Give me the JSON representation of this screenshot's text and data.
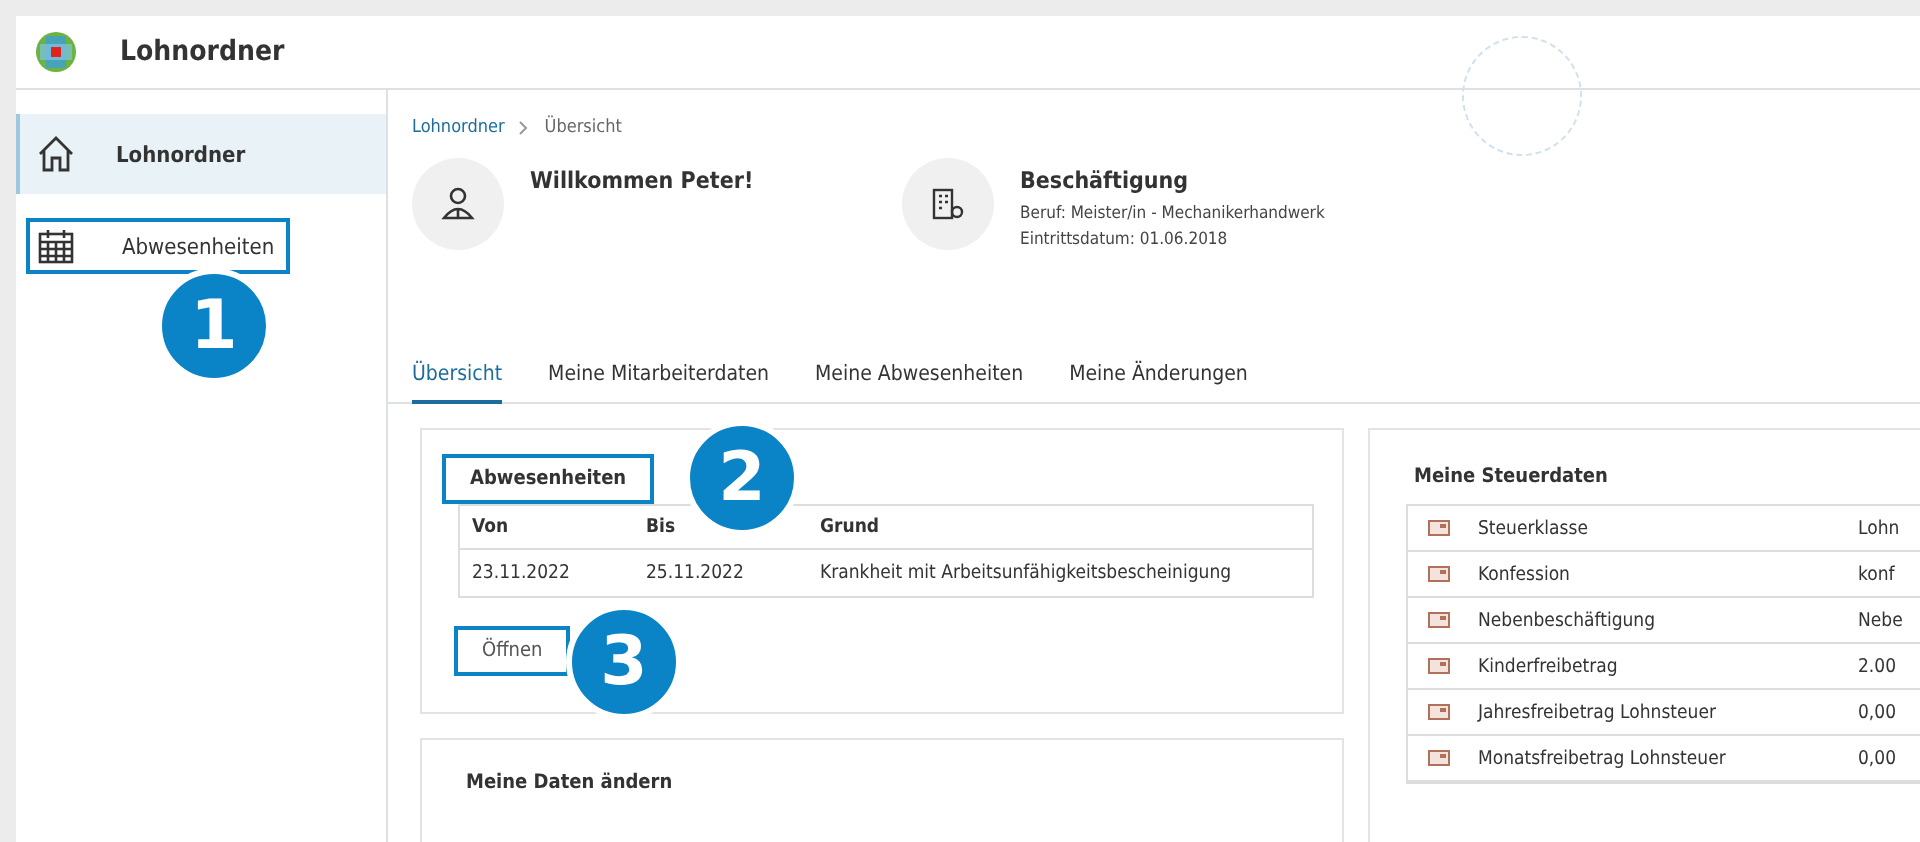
{
  "app": {
    "title": "Lohnordner"
  },
  "sidebar": {
    "items": [
      {
        "label": "Lohnordner",
        "kind": "home",
        "selected": true
      },
      {
        "label": "Abwesenheiten",
        "kind": "calendar",
        "selected": false,
        "callout": "1"
      }
    ]
  },
  "breadcrumb": [
    "Lohnordner",
    "Übersicht"
  ],
  "welcome": {
    "title": "Willkommen Peter!"
  },
  "employment": {
    "title": "Beschäftigung",
    "lines": [
      "Beruf: Meister/in - Mechanikerhandwerk",
      "Eintrittsdatum: 01.06.2018"
    ]
  },
  "tabs": [
    {
      "label": "Übersicht",
      "selected": true
    },
    {
      "label": "Meine Mitarbeiterdaten",
      "selected": false
    },
    {
      "label": "Meine Abwesenheiten",
      "selected": false
    },
    {
      "label": "Meine Änderungen",
      "selected": false
    }
  ],
  "absences": {
    "title": "Abwesenheiten",
    "callout": "2",
    "columns": [
      "Von",
      "Bis",
      "Grund"
    ],
    "rows": [
      [
        "23.11.2022",
        "25.11.2022",
        "Krankheit mit Arbeitsunfähigkeitsbescheinigung"
      ]
    ],
    "button": {
      "label": "Öffnen",
      "callout": "3"
    }
  },
  "change_card": {
    "title": "Meine Daten ändern"
  },
  "tax": {
    "title": "Meine Steuerdaten",
    "rows": [
      {
        "label": "Steuerklasse",
        "value": "Lohn"
      },
      {
        "label": "Konfession",
        "value": "konf"
      },
      {
        "label": "Nebenbeschäftigung",
        "value": "Nebe"
      },
      {
        "label": "Kinderfreibetrag",
        "value": "2.00"
      },
      {
        "label": "Jahresfreibetrag Lohnsteuer",
        "value": "0,00"
      },
      {
        "label": "Monatsfreibetrag Lohnsteuer",
        "value": "0,00"
      }
    ]
  }
}
